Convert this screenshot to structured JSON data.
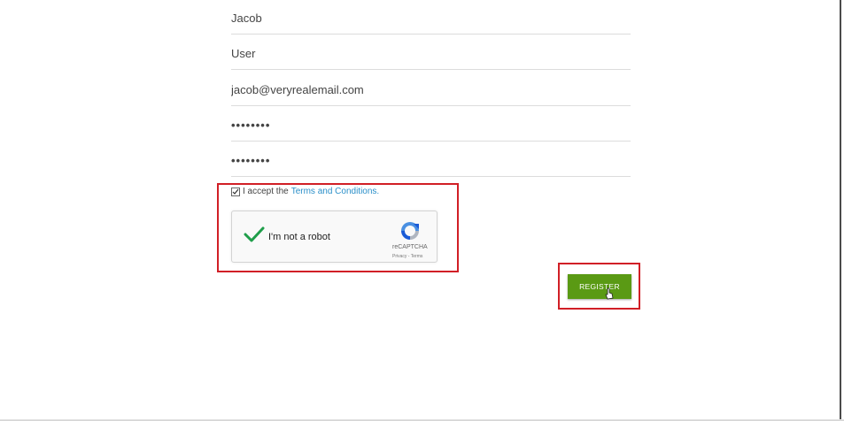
{
  "form": {
    "first_name": "Jacob",
    "last_name": "User",
    "email": "jacob@veryrealemail.com",
    "password": "••••••••",
    "confirm_password": "••••••••"
  },
  "terms": {
    "prefix": "I accept the",
    "link_label": "Terms and Conditions."
  },
  "recaptcha": {
    "label": "I'm not a robot",
    "brand": "reCAPTCHA",
    "privacy": "Privacy",
    "separator": " - ",
    "terms": "Terms"
  },
  "register_button": {
    "label": "REGISTER"
  },
  "colors": {
    "accent_green": "#5a9a14",
    "highlight_red": "#d11f26",
    "link_blue": "#2a8fc9"
  }
}
